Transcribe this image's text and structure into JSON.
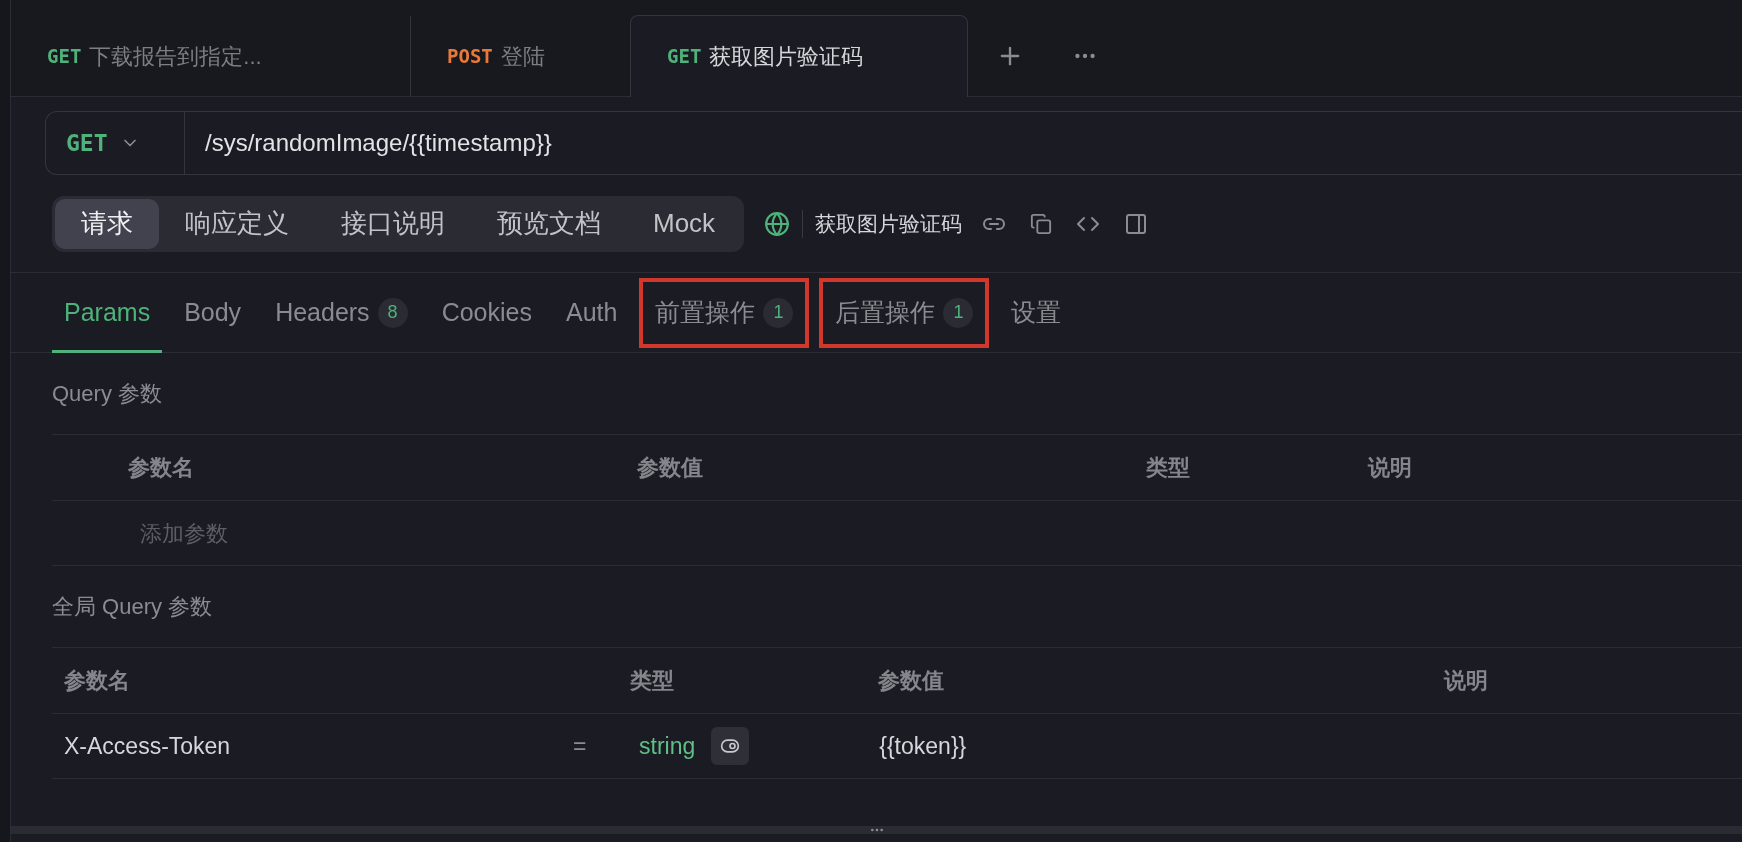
{
  "request_tabs": [
    {
      "method": "GET",
      "kind": "get",
      "name": "下载报告到指定...",
      "selected": false
    },
    {
      "method": "POST",
      "kind": "post",
      "name": "登陆",
      "selected": false
    },
    {
      "method": "GET",
      "kind": "get",
      "name": "获取图片验证码",
      "selected": true
    }
  ],
  "url_bar": {
    "method": "GET",
    "kind": "get",
    "url": "/sys/randomImage/{{timestamp}}"
  },
  "view_tabs": [
    {
      "label": "请求",
      "selected": true
    },
    {
      "label": "响应定义",
      "selected": false
    },
    {
      "label": "接口说明",
      "selected": false
    },
    {
      "label": "预览文档",
      "selected": false
    },
    {
      "label": "Mock",
      "selected": false
    }
  ],
  "endpoint_name": "获取图片验证码",
  "param_tabs": [
    {
      "label": "Params",
      "selected": true,
      "highlighted": false
    },
    {
      "label": "Body",
      "selected": false,
      "highlighted": false
    },
    {
      "label": "Headers",
      "count": "8",
      "selected": false,
      "highlighted": false
    },
    {
      "label": "Cookies",
      "selected": false,
      "highlighted": false
    },
    {
      "label": "Auth",
      "selected": false,
      "highlighted": false
    },
    {
      "label": "前置操作",
      "count": "1",
      "selected": false,
      "highlighted": true
    },
    {
      "label": "后置操作",
      "count": "1",
      "selected": false,
      "highlighted": true
    },
    {
      "label": "设置",
      "selected": false,
      "highlighted": false
    }
  ],
  "query_section": {
    "title": "Query 参数",
    "columns": [
      "参数名",
      "参数值",
      "类型",
      "说明"
    ],
    "add_placeholder": "添加参数"
  },
  "global_section": {
    "title": "全局 Query 参数",
    "columns": [
      "参数名",
      "类型",
      "参数值",
      "说明"
    ],
    "rows": [
      {
        "name": "X-Access-Token",
        "operator": "=",
        "type": "string",
        "value": "{{token}}"
      }
    ]
  }
}
